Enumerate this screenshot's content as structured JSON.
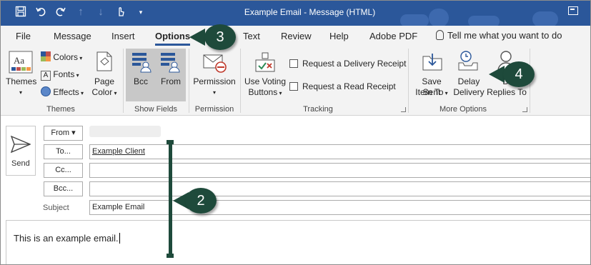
{
  "window": {
    "title": "Example Email  -  Message (HTML)",
    "qat_icons": [
      "save-icon",
      "undo-icon",
      "redo-icon",
      "up-arrow-icon",
      "down-arrow-icon",
      "touch-mode-icon",
      "customize-qat-icon"
    ]
  },
  "tabs": [
    "File",
    "Message",
    "Insert",
    "Options",
    "Text",
    "Review",
    "Help",
    "Adobe PDF"
  ],
  "active_tab": "Options",
  "tell_me": "Tell me what you want to do",
  "ribbon": {
    "themes": {
      "themes_label": "Themes",
      "colors_label": "Colors",
      "fonts_label": "Fonts",
      "effects_label": "Effects",
      "page_color_line1": "Page",
      "page_color_line2": "Color",
      "group_label": "Themes"
    },
    "show_fields": {
      "bcc_label": "Bcc",
      "from_label": "From",
      "group_label": "Show Fields"
    },
    "permission": {
      "permission_label": "Permission",
      "group_label": "Permission"
    },
    "tracking": {
      "voting_line1": "Use Voting",
      "voting_line2": "Buttons",
      "delivery_receipt": "Request a Delivery Receipt",
      "read_receipt": "Request a Read Receipt",
      "group_label": "Tracking"
    },
    "more_options": {
      "save_sent_line1": "Save Sent",
      "save_sent_line2": "Item To",
      "delay_line1": "Delay",
      "delay_line2": "Delivery",
      "direct_line1": "Di",
      "direct_line2": "Replies To",
      "group_label": "More Options"
    }
  },
  "compose": {
    "send_label": "Send",
    "from_button": "From",
    "to_button": "To...",
    "cc_button": "Cc...",
    "bcc_button": "Bcc...",
    "to_value": "Example Client",
    "cc_value": "",
    "bcc_value": "",
    "subject_label": "Subject",
    "subject_value": "Example Email",
    "body_text": "This is an example email."
  },
  "annotations": {
    "callout_2": "2",
    "callout_3": "3",
    "callout_4": "4",
    "color": "#1e4a3b"
  },
  "colors": {
    "titlebar": "#2b579a",
    "ribbon_bg": "#f3f3f3",
    "selected_button": "#c8c8c8"
  }
}
